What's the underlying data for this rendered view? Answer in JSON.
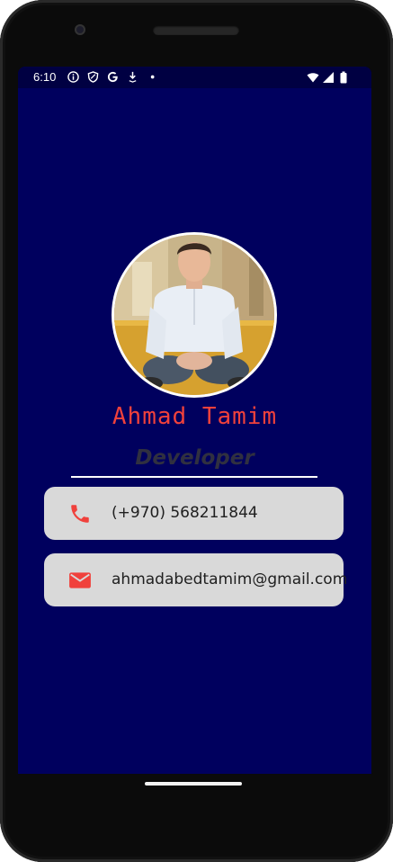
{
  "status_bar": {
    "time": "6:10",
    "icons": [
      "info-icon",
      "shield-icon",
      "google-g-icon",
      "download-icon",
      "dot-icon",
      "wifi-icon",
      "cell-signal-icon",
      "battery-icon"
    ]
  },
  "profile": {
    "name": "Ahmad Tamim",
    "role": "Developer",
    "avatar": "profile-photo"
  },
  "contacts": {
    "phone": {
      "icon": "phone-icon",
      "text": "(+970) 568211844"
    },
    "email": {
      "icon": "email-icon",
      "text": "ahmadabedtamim@gmail.com"
    }
  },
  "colors": {
    "background": "#00005e",
    "name": "#f0413c",
    "card": "#d9d9d9",
    "icon": "#f0413c"
  }
}
